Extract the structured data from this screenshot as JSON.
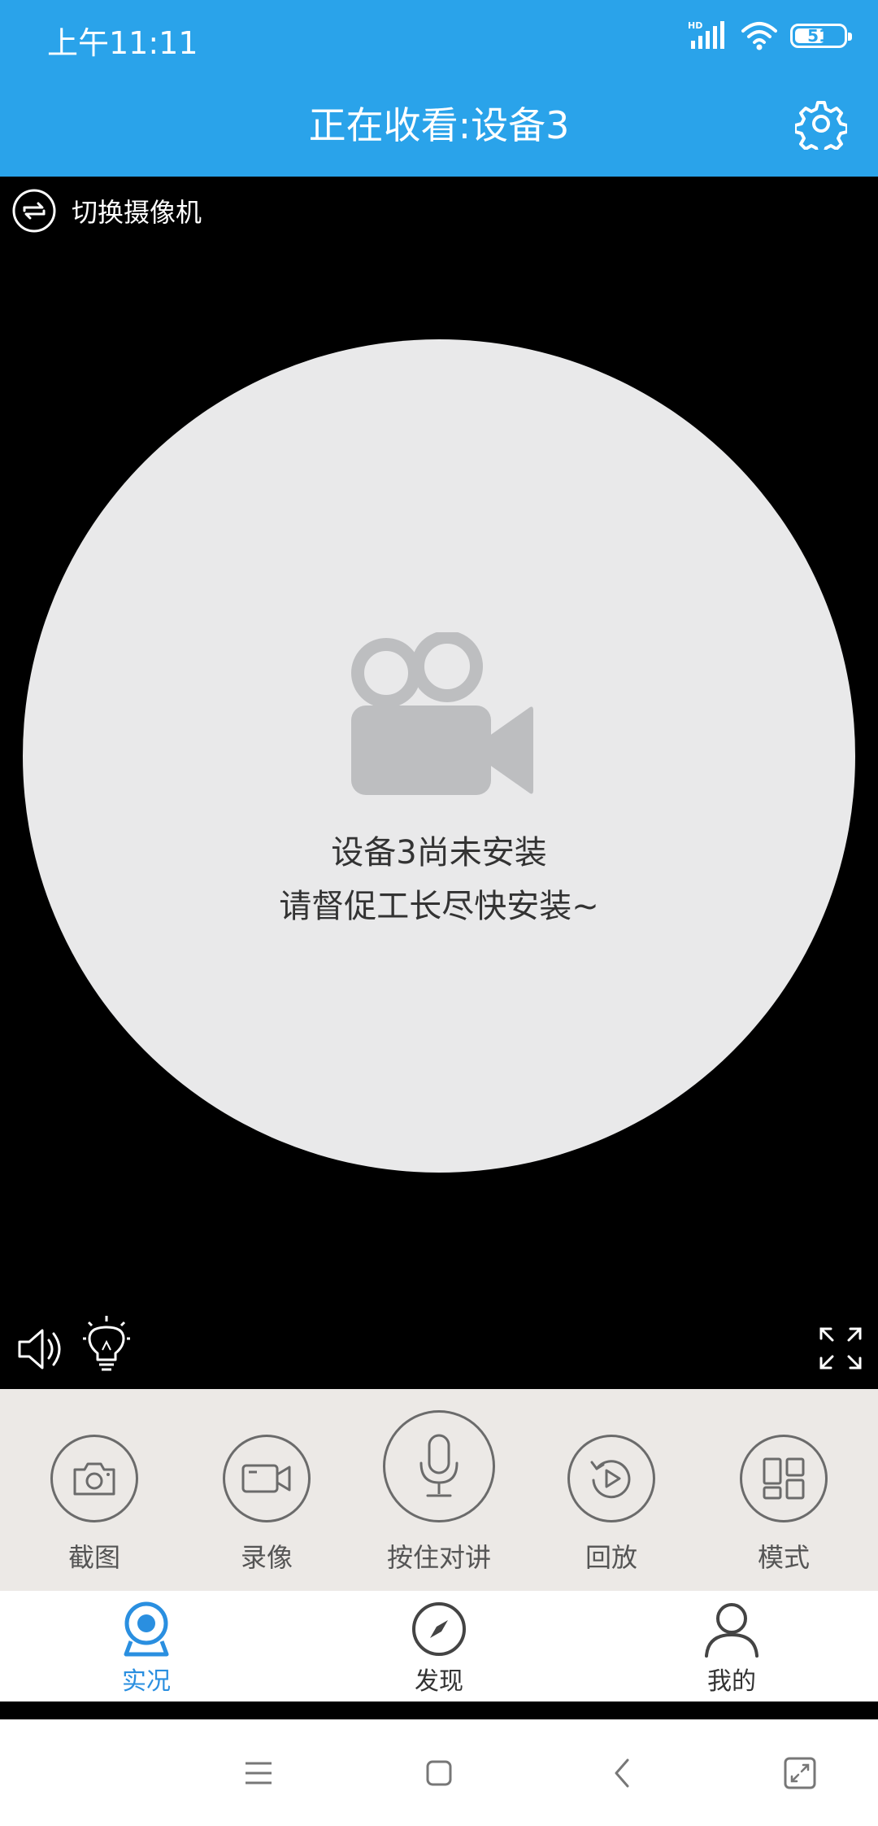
{
  "status_bar": {
    "time": "上午11:11",
    "network_label": "HD",
    "battery": "51",
    "icons": [
      "signal-icon",
      "wifi-icon",
      "battery-icon"
    ]
  },
  "header": {
    "title": "正在收看:设备3",
    "settings_icon": "gear-icon"
  },
  "video": {
    "switch_camera_label": "切换摄像机",
    "message_line1": "设备3尚未安装",
    "message_line2": "请督促工长尽快安装~",
    "placeholder_icon": "video-camera-icon"
  },
  "controls": [
    {
      "label": "截图",
      "icon": "camera-icon"
    },
    {
      "label": "录像",
      "icon": "video-record-icon"
    },
    {
      "label": "按住对讲",
      "icon": "microphone-icon"
    },
    {
      "label": "回放",
      "icon": "replay-icon"
    },
    {
      "label": "模式",
      "icon": "grid-mode-icon"
    }
  ],
  "bottom_nav": [
    {
      "label": "实况",
      "icon": "webcam-icon",
      "active": true
    },
    {
      "label": "发现",
      "icon": "compass-icon",
      "active": false
    },
    {
      "label": "我的",
      "icon": "person-icon",
      "active": false
    }
  ],
  "colors": {
    "primary": "#2aa3ea",
    "active_tab": "#2a8fe0",
    "placeholder_bg": "#e9e9ea",
    "control_bg": "#ece9e6"
  }
}
